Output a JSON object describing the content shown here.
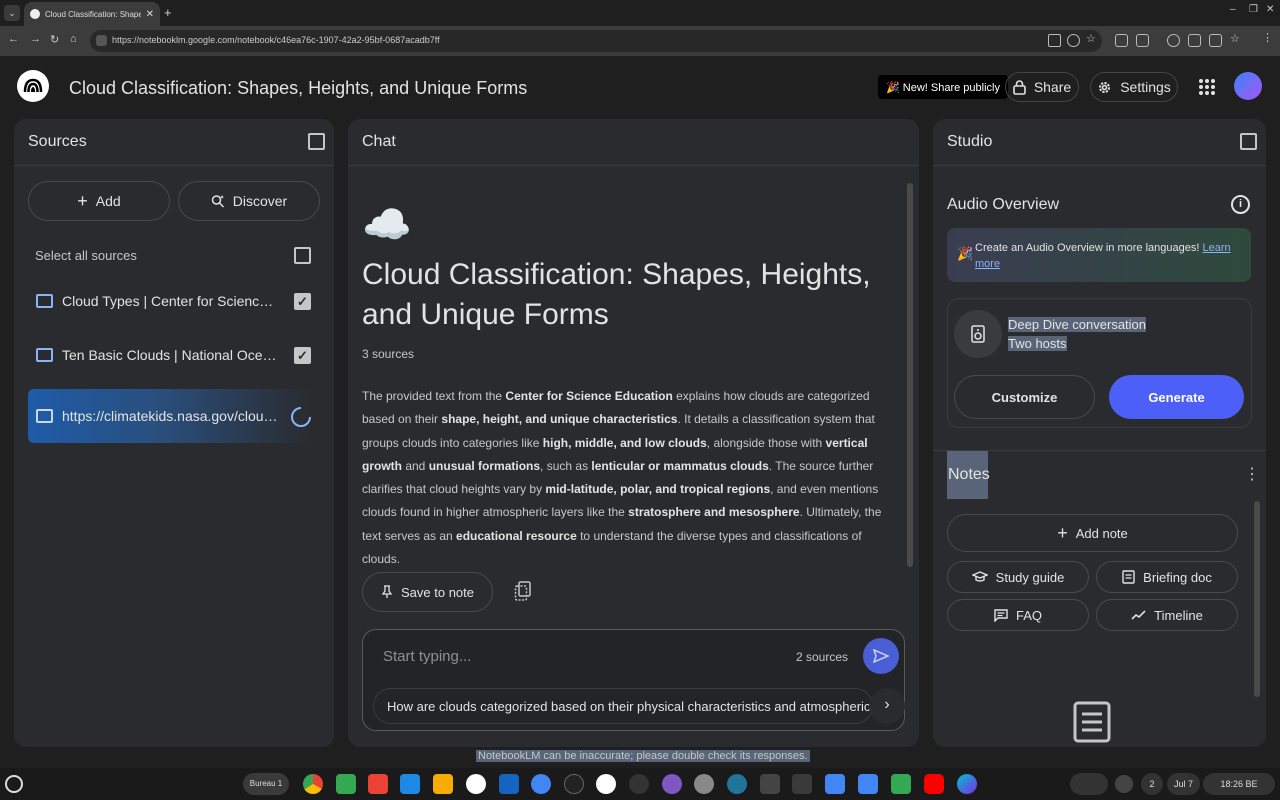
{
  "browser": {
    "tab_title": "Cloud Classification: Shapes, H",
    "url": "https://notebooklm.google.com/notebook/c46ea76c-1907-42a2-95bf-0687acadb7ff"
  },
  "header": {
    "title": "Cloud Classification: Shapes, Heights, and Unique Forms",
    "new_share": "🎉 New! Share publicly",
    "share_label": "Share",
    "settings_label": "Settings"
  },
  "sources": {
    "title": "Sources",
    "add_label": "Add",
    "discover_label": "Discover",
    "select_all": "Select all sources",
    "items": [
      {
        "label": "Cloud Types | Center for Science Educ...",
        "checked": true
      },
      {
        "label": "Ten Basic Clouds | National Oceanic a...",
        "checked": true
      },
      {
        "label": "https://climatekids.nasa.gov/cloud-for...",
        "loading": true
      }
    ]
  },
  "chat": {
    "title": "Chat",
    "emoji": "☁️",
    "notebook_title": "Cloud Classification: Shapes, Heights, and Unique Forms",
    "source_count": "3 sources",
    "summary_parts": {
      "p1": "The provided text from the ",
      "b1": "Center for Science Education",
      "p2": " explains how clouds are categorized based on their ",
      "b2": "shape, height, and unique characteristics",
      "p3": ". It details a classification system that groups clouds into categories like ",
      "b3": "high, middle, and low clouds",
      "p4": ", alongside those with ",
      "b4": "vertical growth",
      "p5": " and ",
      "b5": "unusual formations",
      "p6": ", such as ",
      "b6": "lenticular or mammatus clouds",
      "p7": ". The source further clarifies that cloud heights vary by ",
      "b7": "mid-latitude, polar, and tropical regions",
      "p8": ", and even mentions clouds found in higher atmospheric layers like the ",
      "b8": "stratosphere and mesosphere",
      "p9": ". Ultimately, the text serves as an ",
      "b9": "educational resource",
      "p10": " to understand the diverse types and classifications of clouds."
    },
    "save_to_note": "Save to note",
    "input_placeholder": "Start typing...",
    "input_sources": "2 sources",
    "suggestion": "How are clouds categorized based on their physical characteristics and atmospheric lo"
  },
  "studio": {
    "title": "Studio",
    "audio_overview": "Audio Overview",
    "promo_text": "Create an Audio Overview in more languages! ",
    "promo_link": "Learn more",
    "deep_dive_title": "Deep Dive conversation",
    "deep_dive_sub": "Two hosts",
    "customize": "Customize",
    "generate": "Generate",
    "notes_title": "Notes",
    "add_note": "Add note",
    "study_guide": "Study guide",
    "briefing_doc": "Briefing doc",
    "faq": "FAQ",
    "timeline": "Timeline"
  },
  "footer": {
    "disclaimer": "NotebookLM can be inaccurate; please double check its responses."
  },
  "taskbar": {
    "desk": "Bureau 1",
    "date": "Jul 7",
    "time": "18:26 BE",
    "notification_count": "2"
  }
}
